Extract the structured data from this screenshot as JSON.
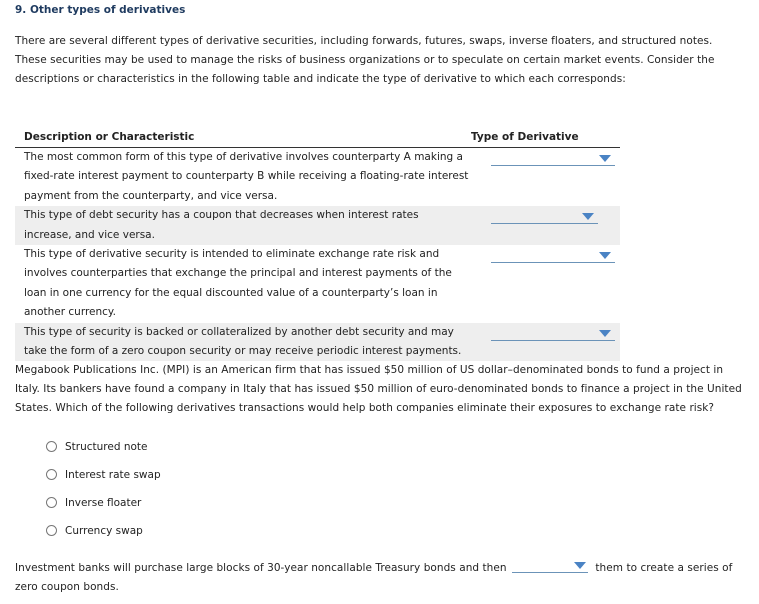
{
  "question": {
    "title": "9. Other types of derivatives",
    "intro": "There are several different types of derivative securities, including forwards, futures, swaps, inverse floaters, and structured notes. These securities may be used to manage the risks of business organizations or to speculate on certain market events. Consider the descriptions or characteristics in the following table and indicate the type of derivative to which each corresponds:"
  },
  "table": {
    "headers": [
      "Description or Characteristic",
      "Type of Derivative"
    ],
    "rows": [
      {
        "description": "The most common form of this type of derivative involves counterparty A making a fixed-rate interest payment to counterparty B while receiving a floating-rate interest payment from the counterparty, and vice versa.",
        "selected": ""
      },
      {
        "description": "This type of debt security has a coupon that decreases when interest rates increase, and vice versa.",
        "selected": ""
      },
      {
        "description": "This type of derivative security is intended to eliminate exchange rate risk and involves counterparties that exchange the principal and interest payments of the loan in one currency for the equal discounted value of a counterparty’s loan in another currency.",
        "selected": ""
      },
      {
        "description": "This type of security is backed or collateralized by another debt security and may take the form of a zero coupon security or may receive periodic interest payments.",
        "selected": ""
      }
    ]
  },
  "mpi_question": {
    "text": "Megabook Publications Inc. (MPI) is an American firm that has issued $50 million of US dollar–denominated bonds to fund a project in Italy. Its bankers have found a company in Italy that has issued $50 million of euro-denominated bonds to finance a project in the United States. Which of the following derivatives transactions would help both companies eliminate their exposures to exchange rate risk?",
    "options": [
      "Structured note",
      "Interest rate swap",
      "Inverse floater",
      "Currency swap"
    ],
    "selected": null
  },
  "final_question": {
    "before": "Investment banks will purchase large blocks of 30-year noncallable Treasury bonds and then",
    "selected": "",
    "after": "them to create a series of zero coupon bonds."
  },
  "colors": {
    "title": "#1e3a5f",
    "dropdown_caret": "#4a83c4",
    "dropdown_underline": "#6b93b8",
    "row_shade": "#eeeeee"
  },
  "icons": {
    "dropdown": "caret-down-icon",
    "radio": "radio-unchecked-icon"
  }
}
